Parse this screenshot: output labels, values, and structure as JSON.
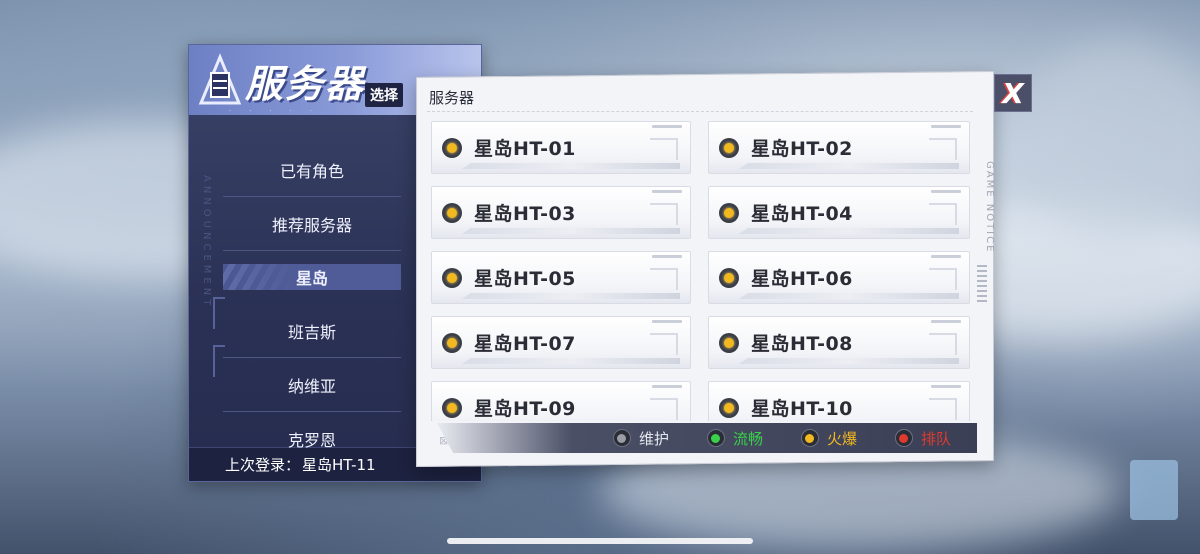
{
  "left_panel": {
    "title": "服务器",
    "subtitle": "选择",
    "vertical_text": "ANNOUNCEMENT",
    "nav_items": [
      {
        "label": "已有角色",
        "active": false
      },
      {
        "label": "推荐服务器",
        "active": false
      },
      {
        "label": "星岛",
        "active": true
      },
      {
        "label": "班吉斯",
        "active": false
      },
      {
        "label": "纳维亚",
        "active": false
      },
      {
        "label": "克罗恩",
        "active": false
      }
    ],
    "last_login_label": "上次登录：",
    "last_login_value": "星岛HT-11"
  },
  "main_panel": {
    "title": "服务器",
    "side_text": "GAME NOTICE",
    "servers": [
      {
        "name": "星岛HT-01",
        "status": "busy"
      },
      {
        "name": "星岛HT-02",
        "status": "busy"
      },
      {
        "name": "星岛HT-03",
        "status": "busy"
      },
      {
        "name": "星岛HT-04",
        "status": "busy"
      },
      {
        "name": "星岛HT-05",
        "status": "busy"
      },
      {
        "name": "星岛HT-06",
        "status": "busy"
      },
      {
        "name": "星岛HT-07",
        "status": "busy"
      },
      {
        "name": "星岛HT-08",
        "status": "busy"
      },
      {
        "name": "星岛HT-09",
        "status": "busy"
      },
      {
        "name": "星岛HT-10",
        "status": "busy"
      }
    ],
    "legend": [
      {
        "label": "维护",
        "color": "#9a9ca6",
        "text_color": "#e4e6ee"
      },
      {
        "label": "流畅",
        "color": "#39d04a",
        "text_color": "#39d04a"
      },
      {
        "label": "火爆",
        "color": "#f2b81f",
        "text_color": "#f2b81f"
      },
      {
        "label": "排队",
        "color": "#e03a2f",
        "text_color": "#e03a2f"
      }
    ]
  },
  "close_button": {
    "icon": "close-icon",
    "glyph": "X"
  },
  "colors": {
    "status_busy": "#f2b81f",
    "panel_dark": "#2a3155",
    "panel_light": "#f3f4f7"
  }
}
